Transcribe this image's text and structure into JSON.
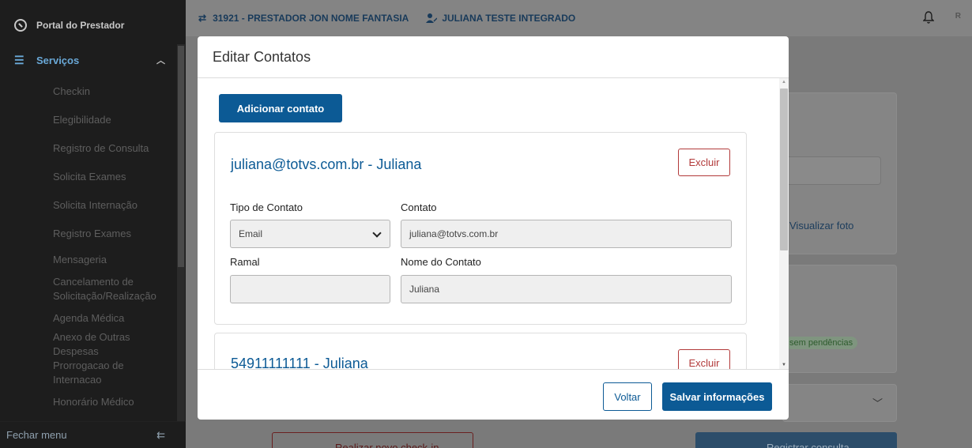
{
  "sidebar": {
    "brand": "Portal do Prestador",
    "menu_title": "Serviços",
    "items": [
      {
        "label": "Checkin"
      },
      {
        "label": "Elegibilidade"
      },
      {
        "label": "Registro de Consulta"
      },
      {
        "label": "Solicita Exames"
      },
      {
        "label": "Solicita Internação"
      },
      {
        "label": "Registro Exames"
      },
      {
        "label": "Mensageria"
      },
      {
        "label": "Cancelamento de Solicitação/Realização"
      },
      {
        "label": "Agenda Médica"
      },
      {
        "label": "Anexo de Outras Despesas"
      },
      {
        "label": "Prorrogacao de Internacao"
      },
      {
        "label": "Honorário Médico"
      }
    ],
    "close_menu": "Fechar menu"
  },
  "topbar": {
    "provider": "31921 - PRESTADOR JON NOME FANTASIA",
    "user": "JULIANA TESTE INTEGRADO",
    "avatar_letter": "R"
  },
  "background": {
    "view_photo": "Visualizar foto",
    "no_pending": "sem pendências",
    "new_checkin": "Realizar novo check-in",
    "register_consult": "Registrar consulta"
  },
  "modal": {
    "title": "Editar Contatos",
    "add_button": "Adicionar contato",
    "contacts": [
      {
        "title": "juliana@totvs.com.br - Juliana",
        "delete_label": "Excluir",
        "type_label": "Tipo de Contato",
        "type_value": "Email",
        "contact_label": "Contato",
        "contact_value": "juliana@totvs.com.br",
        "ramal_label": "Ramal",
        "ramal_value": "",
        "name_label": "Nome do Contato",
        "name_value": "Juliana"
      },
      {
        "title": "54911111111 - Juliana",
        "delete_label": "Excluir"
      }
    ],
    "back_button": "Voltar",
    "save_button": "Salvar informações"
  },
  "colors": {
    "primary": "#0c5a95",
    "danger": "#b23a3a",
    "sidebar_bg": "#1d1d1d"
  }
}
